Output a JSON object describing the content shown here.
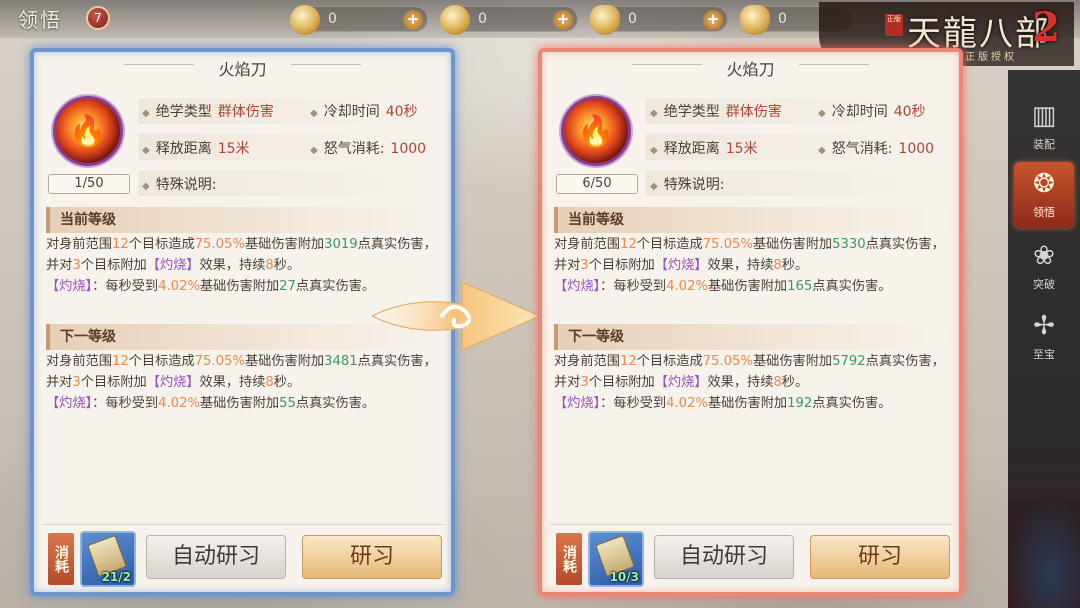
{
  "top": {
    "title": "领悟",
    "badge": "7",
    "resources": [
      {
        "icon": "coin-icon",
        "value": "0"
      },
      {
        "icon": "gold-coin-icon",
        "value": "0"
      },
      {
        "icon": "ingot-icon",
        "value": "0"
      },
      {
        "icon": "gold-ingot-icon",
        "value": "0"
      }
    ],
    "plus_label": "+"
  },
  "logo": {
    "name": "天龍八部",
    "suffix": "2",
    "seal": "正版",
    "sub": "金庸正版授权"
  },
  "side_menu": [
    {
      "label": "装配",
      "icon": "book-icon",
      "glyph": "▥",
      "active": false
    },
    {
      "label": "领悟",
      "icon": "swirl-icon",
      "glyph": "❂",
      "active": true
    },
    {
      "label": "突破",
      "icon": "lotus-icon",
      "glyph": "❀",
      "active": false
    },
    {
      "label": "至宝",
      "icon": "sword-icon",
      "glyph": "✢",
      "active": false
    }
  ],
  "panels": {
    "left": {
      "title": "火焰刀",
      "level": "1/50",
      "attrs": {
        "type_label": "绝学类型",
        "type_value": "群体伤害",
        "cooldown_label": "冷却时间",
        "cooldown_value": "40秒",
        "range_label": "释放距离",
        "range_value": "15米",
        "rage_label": "怒气消耗:",
        "rage_value": "1000",
        "special_label": "特殊说明:"
      },
      "current_heading": "当前等级",
      "current": {
        "p1": "对身前范围",
        "targets": "12",
        "p2": "个目标造成",
        "pct": "75.05%",
        "p3": "基础伤害附加",
        "dmg": "3019",
        "p4": "点真实伤害，并对",
        "n": "3",
        "p5": "个目标附加",
        "burn": "【灼烧】",
        "p6": "效果，持续",
        "dur": "8",
        "p7": "秒。",
        "burn2": "【灼烧】",
        "p8": "：每秒受到",
        "pct2": "4.02%",
        "p9": "基础伤害附加",
        "dmg2": "27",
        "p10": "点真实伤害。"
      },
      "next_heading": "下一等级",
      "next": {
        "p1": "对身前范围",
        "targets": "12",
        "p2": "个目标造成",
        "pct": "75.05%",
        "p3": "基础伤害附加",
        "dmg": "3481",
        "p4": "点真实伤害，并对",
        "n": "3",
        "p5": "个目标附加",
        "burn": "【灼烧】",
        "p6": "效果，持续",
        "dur": "8",
        "p7": "秒。",
        "burn2": "【灼烧】",
        "p8": "：每秒受到",
        "pct2": "4.02%",
        "p9": "基础伤害附加",
        "dmg2": "55",
        "p10": "点真实伤害。"
      },
      "consume_label": "消耗",
      "item_count": "21/2",
      "auto_button": "自动研习",
      "study_button": "研习"
    },
    "right": {
      "title": "火焰刀",
      "level": "6/50",
      "attrs": {
        "type_label": "绝学类型",
        "type_value": "群体伤害",
        "cooldown_label": "冷却时间",
        "cooldown_value": "40秒",
        "range_label": "释放距离",
        "range_value": "15米",
        "rage_label": "怒气消耗:",
        "rage_value": "1000",
        "special_label": "特殊说明:"
      },
      "current_heading": "当前等级",
      "current": {
        "p1": "对身前范围",
        "targets": "12",
        "p2": "个目标造成",
        "pct": "75.05%",
        "p3": "基础伤害附加",
        "dmg": "5330",
        "p4": "点真实伤害，并对",
        "n": "3",
        "p5": "个目标附加",
        "burn": "【灼烧】",
        "p6": "效果，持续",
        "dur": "8",
        "p7": "秒。",
        "burn2": "【灼烧】",
        "p8": "：每秒受到",
        "pct2": "4.02%",
        "p9": "基础伤害附加",
        "dmg2": "165",
        "p10": "点真实伤害。"
      },
      "next_heading": "下一等级",
      "next": {
        "p1": "对身前范围",
        "targets": "12",
        "p2": "个目标造成",
        "pct": "75.05%",
        "p3": "基础伤害附加",
        "dmg": "5792",
        "p4": "点真实伤害，并对",
        "n": "3",
        "p5": "个目标附加",
        "burn": "【灼烧】",
        "p6": "效果，持续",
        "dur": "8",
        "p7": "秒。",
        "burn2": "【灼烧】",
        "p8": "：每秒受到",
        "pct2": "4.02%",
        "p9": "基础伤害附加",
        "dmg2": "192",
        "p10": "点真实伤害。"
      },
      "consume_label": "消耗",
      "item_count": "10/3",
      "auto_button": "自动研习",
      "study_button": "研习"
    }
  },
  "colors": {
    "left_frame": "#6f95cf",
    "right_frame": "#ee8576",
    "highlight_orange": "#ef8a4c",
    "highlight_green": "#3b9a5b",
    "highlight_purple": "#9a4fc4"
  }
}
